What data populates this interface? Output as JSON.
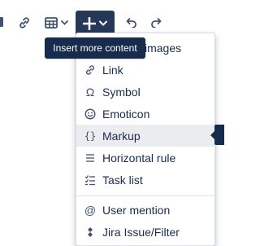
{
  "toolbar": {
    "insert_button_icon": "plus-icon",
    "insert_dropdown_icon": "chevron-down-icon",
    "tooltip": "Insert more content"
  },
  "menu": {
    "items": [
      {
        "label": "images",
        "icon": "image-icon"
      },
      {
        "label": "Link",
        "icon": "link-icon"
      },
      {
        "label": "Symbol",
        "icon": "omega-icon"
      },
      {
        "label": "Emoticon",
        "icon": "smiley-icon"
      },
      {
        "label": "Markup",
        "icon": "braces-icon"
      },
      {
        "label": "Horizontal rule",
        "icon": "horizontal-rule-icon"
      },
      {
        "label": "Task list",
        "icon": "task-list-icon"
      },
      {
        "label": "User mention",
        "icon": "at-icon"
      },
      {
        "label": "Jira Issue/Filter",
        "icon": "jira-icon"
      }
    ]
  },
  "colors": {
    "insert_button_bg": "#253858",
    "tooltip_bg": "#172b4d",
    "hover_bg": "#ebecf0",
    "text": "#172b4d"
  }
}
